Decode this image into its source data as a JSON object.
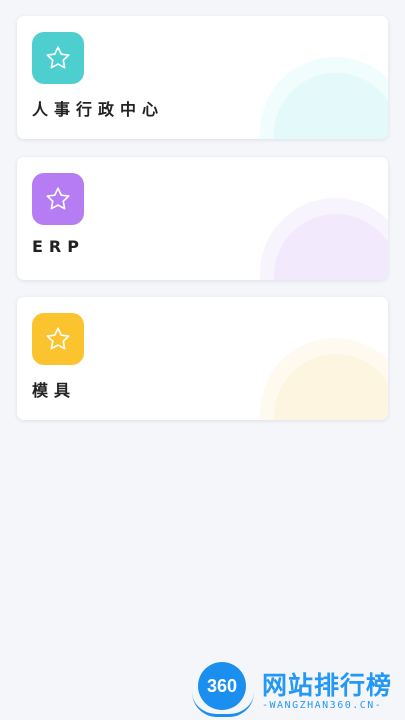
{
  "cards": [
    {
      "title": "人事行政中心",
      "icon": "star-icon",
      "color": "#4ecfcf",
      "deco": "#d8f6f6"
    },
    {
      "title": "ERP",
      "icon": "star-icon",
      "color": "#b57cf3",
      "deco": "#ece0fb"
    },
    {
      "title": "模具",
      "icon": "star-icon",
      "color": "#fbc32e",
      "deco": "#fdf1d5"
    }
  ],
  "watermark": {
    "badge": "360",
    "title": "网站排行榜",
    "subtitle": "-WANGZHAN360.CN-"
  },
  "colors": {
    "background": "#f4f6fa",
    "card": "#ffffff",
    "text": "#222222",
    "brand": "#1a8ff0"
  }
}
